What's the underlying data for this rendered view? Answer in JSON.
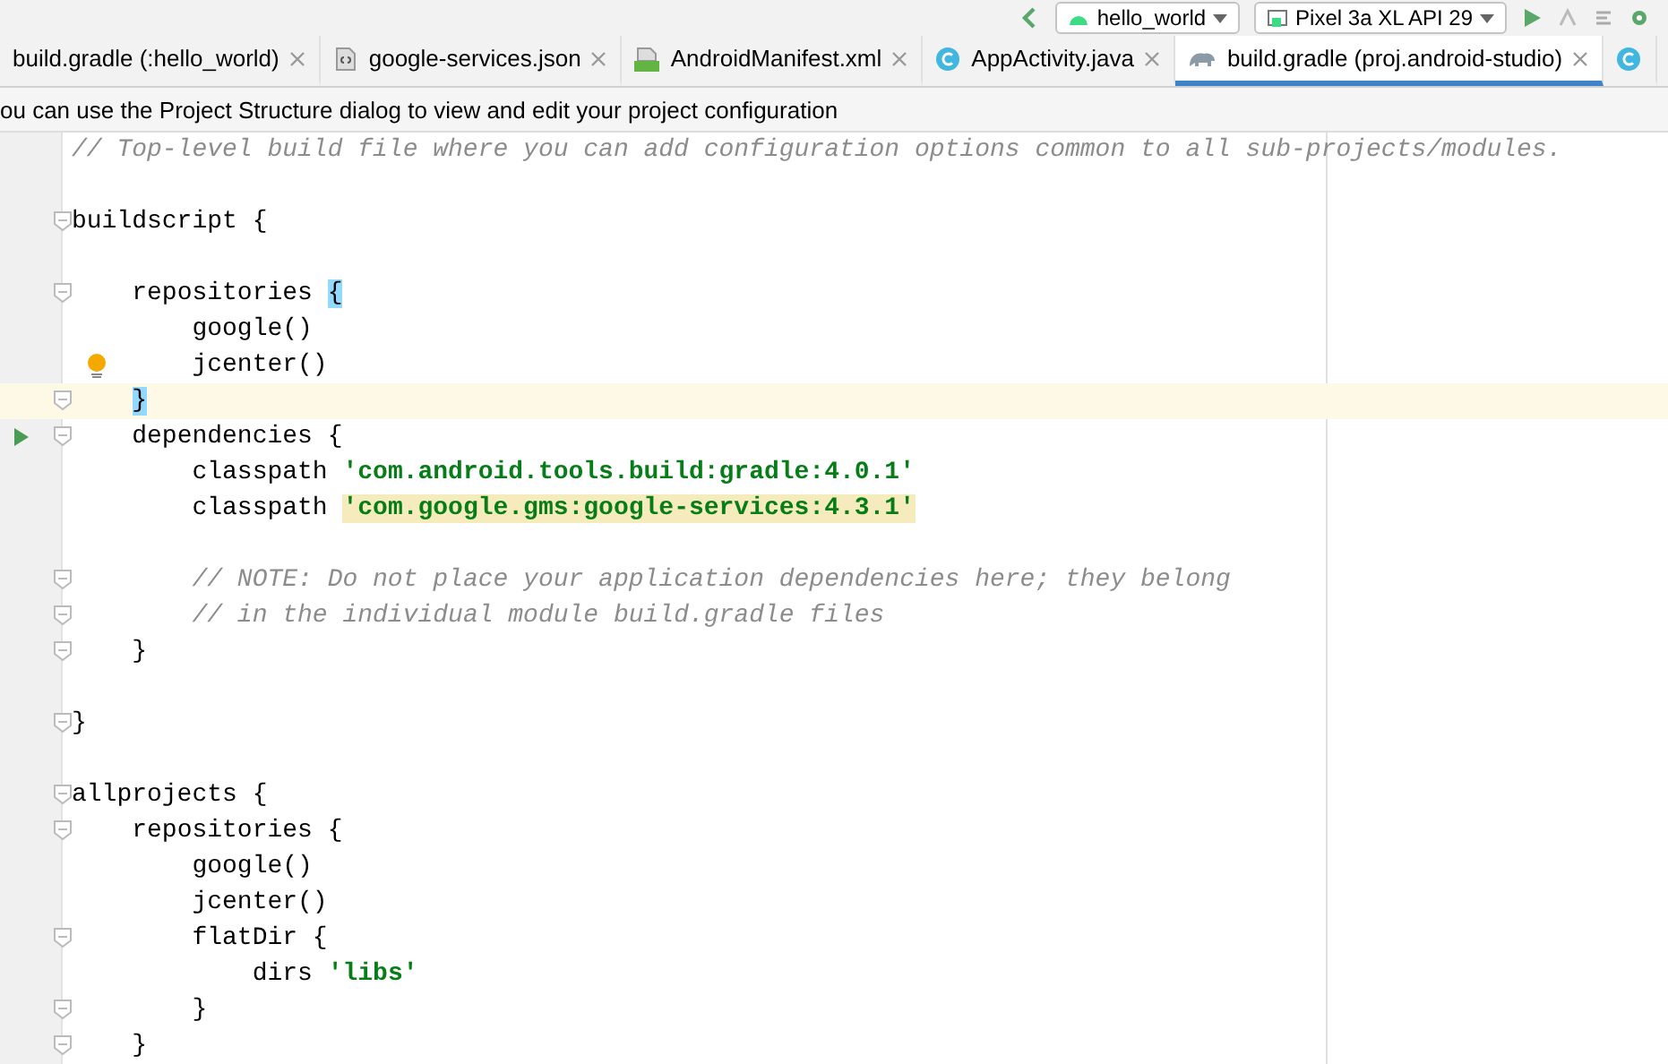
{
  "toolbar": {
    "config": "hello_world",
    "device": "Pixel 3a XL API 29"
  },
  "tabs": [
    {
      "label": "build.gradle (:hello_world)",
      "kind": "plain",
      "selected": false
    },
    {
      "label": "google-services.json",
      "kind": "json",
      "selected": false
    },
    {
      "label": "AndroidManifest.xml",
      "kind": "manifest",
      "selected": false
    },
    {
      "label": "AppActivity.java",
      "kind": "class",
      "selected": false
    },
    {
      "label": "build.gradle (proj.android-studio)",
      "kind": "gradle",
      "selected": true
    },
    {
      "kind": "class",
      "selected": false
    }
  ],
  "banner": "ou can use the Project Structure dialog to view and edit your project configuration",
  "lines": [
    {
      "current": false,
      "tokens": [
        {
          "kind": "comment",
          "text": "// Top-level build file where you can add configuration options common to all sub-projects/modules."
        }
      ]
    },
    {
      "current": false
    },
    {
      "marks": [
        {
          "kind": "fold"
        }
      ],
      "current": false,
      "tokens": [
        {
          "kind": "plain",
          "text": "buildscript {"
        }
      ]
    },
    {
      "current": false
    },
    {
      "marks": [
        {
          "kind": "fold"
        }
      ],
      "current": false,
      "tokens": [
        {
          "kind": "plain",
          "text": "    repositories "
        },
        {
          "kind": "brace-hl",
          "text": "{"
        }
      ]
    },
    {
      "current": false,
      "tokens": [
        {
          "kind": "plain",
          "text": "        google()"
        }
      ]
    },
    {
      "marks": [
        {
          "kind": "bulb"
        }
      ],
      "current": false,
      "tokens": [
        {
          "kind": "plain",
          "text": "        jcenter()"
        }
      ]
    },
    {
      "marks": [
        {
          "kind": "fold"
        }
      ],
      "current": true,
      "tokens": [
        {
          "kind": "brace-hl",
          "text": "    }"
        }
      ]
    },
    {
      "marks": [
        {
          "kind": "run"
        },
        {
          "kind": "fold"
        }
      ],
      "current": false,
      "tokens": [
        {
          "kind": "plain",
          "text": "    dependencies {"
        }
      ]
    },
    {
      "current": false,
      "tokens": [
        {
          "kind": "plain",
          "text": "        classpath "
        },
        {
          "kind": "string",
          "text": "'com.android.tools.build:gradle:4.0.1'"
        }
      ]
    },
    {
      "current": false,
      "tokens": [
        {
          "kind": "plain",
          "text": "        classpath "
        },
        {
          "kind": "string-hl",
          "text": "'com.google.gms:google-services:4.3.1'"
        }
      ]
    },
    {
      "current": false
    },
    {
      "marks": [
        {
          "kind": "fold"
        }
      ],
      "current": false,
      "tokens": [
        {
          "kind": "comment",
          "text": "        // NOTE: Do not place your application dependencies here; they belong"
        }
      ]
    },
    {
      "marks": [
        {
          "kind": "fold"
        }
      ],
      "current": false,
      "tokens": [
        {
          "kind": "comment",
          "text": "        // in the individual module build.gradle files"
        }
      ]
    },
    {
      "marks": [
        {
          "kind": "fold"
        }
      ],
      "current": false,
      "tokens": [
        {
          "kind": "plain",
          "text": "    }"
        }
      ]
    },
    {
      "current": false
    },
    {
      "marks": [
        {
          "kind": "fold"
        }
      ],
      "current": false,
      "tokens": [
        {
          "kind": "plain",
          "text": "}"
        }
      ]
    },
    {
      "current": false
    },
    {
      "marks": [
        {
          "kind": "fold"
        }
      ],
      "current": false,
      "tokens": [
        {
          "kind": "plain",
          "text": "allprojects {"
        }
      ]
    },
    {
      "marks": [
        {
          "kind": "fold"
        }
      ],
      "current": false,
      "tokens": [
        {
          "kind": "plain",
          "text": "    repositories {"
        }
      ]
    },
    {
      "current": false,
      "tokens": [
        {
          "kind": "plain",
          "text": "        google()"
        }
      ]
    },
    {
      "current": false,
      "tokens": [
        {
          "kind": "plain",
          "text": "        jcenter()"
        }
      ]
    },
    {
      "marks": [
        {
          "kind": "fold"
        }
      ],
      "current": false,
      "tokens": [
        {
          "kind": "plain",
          "text": "        flatDir {"
        }
      ]
    },
    {
      "current": false,
      "tokens": [
        {
          "kind": "plain",
          "text": "            dirs "
        },
        {
          "kind": "string",
          "text": "'libs'"
        }
      ]
    },
    {
      "marks": [
        {
          "kind": "fold"
        }
      ],
      "current": false,
      "tokens": [
        {
          "kind": "plain",
          "text": "        }"
        }
      ]
    },
    {
      "marks": [
        {
          "kind": "fold"
        }
      ],
      "current": false,
      "tokens": [
        {
          "kind": "plain",
          "text": "    }"
        }
      ]
    }
  ]
}
